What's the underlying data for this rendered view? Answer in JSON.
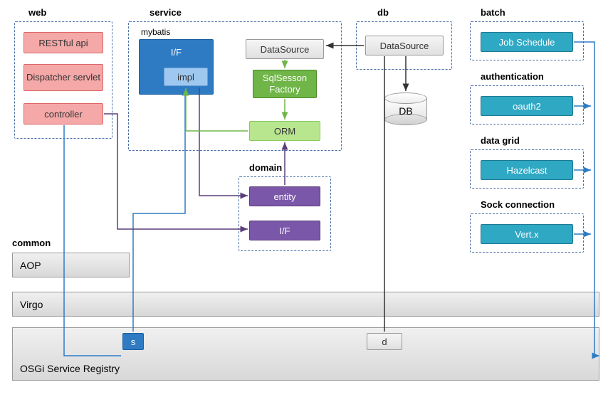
{
  "groups": {
    "web": {
      "label": "web",
      "items": [
        "RESTful api",
        "Dispatcher servlet",
        "controller"
      ]
    },
    "service": {
      "label": "service",
      "mybatis": "mybatis",
      "if_block": "I/F",
      "impl": "impl",
      "datasource": "DataSource",
      "sqlsession": "SqlSesson Factory",
      "orm": "ORM"
    },
    "domain": {
      "label": "domain",
      "entity": "entity",
      "if": "I/F"
    },
    "db": {
      "label": "db",
      "datasource": "DataSource",
      "db_cylinder": "DB"
    },
    "batch": {
      "label": "batch",
      "item": "Job Schedule"
    },
    "authentication": {
      "label": "authentication",
      "item": "oauth2"
    },
    "datagrid": {
      "label": "data grid",
      "item": "Hazelcast"
    },
    "sock": {
      "label": "Sock connection",
      "item": "Vert.x"
    }
  },
  "common_label": "common",
  "bars": {
    "aop": "AOP",
    "virgo": "Virgo",
    "osgi": "OSGi Service Registry"
  },
  "registry_nodes": {
    "s": "s",
    "d": "d"
  },
  "chart_data": {
    "type": "architecture-diagram",
    "modules": [
      {
        "name": "web",
        "components": [
          "RESTful api",
          "Dispatcher servlet",
          "controller"
        ]
      },
      {
        "name": "service",
        "components": [
          "mybatis I/F",
          "impl",
          "DataSource",
          "SqlSesson Factory",
          "ORM"
        ]
      },
      {
        "name": "domain",
        "components": [
          "entity",
          "I/F"
        ]
      },
      {
        "name": "db",
        "components": [
          "DataSource",
          "DB"
        ]
      },
      {
        "name": "batch",
        "components": [
          "Job Schedule"
        ]
      },
      {
        "name": "authentication",
        "components": [
          "oauth2"
        ]
      },
      {
        "name": "data grid",
        "components": [
          "Hazelcast"
        ]
      },
      {
        "name": "Sock connection",
        "components": [
          "Vert.x"
        ]
      }
    ],
    "layers": [
      "AOP",
      "Virgo",
      "OSGi Service Registry"
    ],
    "registry_services": [
      "s",
      "d"
    ],
    "connections": [
      {
        "from": "web.controller",
        "to": "registry.s",
        "style": "blue"
      },
      {
        "from": "registry.s",
        "to": "service.impl",
        "style": "blue"
      },
      {
        "from": "service.impl",
        "to": "domain.entity",
        "style": "purple"
      },
      {
        "from": "web.controller",
        "to": "domain.entity",
        "style": "purple"
      },
      {
        "from": "domain",
        "to": "service.ORM",
        "style": "purple"
      },
      {
        "from": "service.DataSource",
        "to": "service.SqlSessonFactory",
        "style": "green"
      },
      {
        "from": "service.SqlSessonFactory",
        "to": "service.ORM",
        "style": "green"
      },
      {
        "from": "db.DataSource",
        "to": "service.DataSource",
        "style": "black"
      },
      {
        "from": "db.DataSource",
        "to": "db.DB",
        "style": "black"
      },
      {
        "from": "db.DataSource",
        "to": "registry.d",
        "style": "black"
      },
      {
        "from": "batch.JobSchedule",
        "to": "registry",
        "style": "blue"
      },
      {
        "from": "authentication.oauth2",
        "to": "registry",
        "style": "blue"
      },
      {
        "from": "datagrid.Hazelcast",
        "to": "registry",
        "style": "blue"
      },
      {
        "from": "sock.Vert.x",
        "to": "registry",
        "style": "blue"
      }
    ]
  }
}
